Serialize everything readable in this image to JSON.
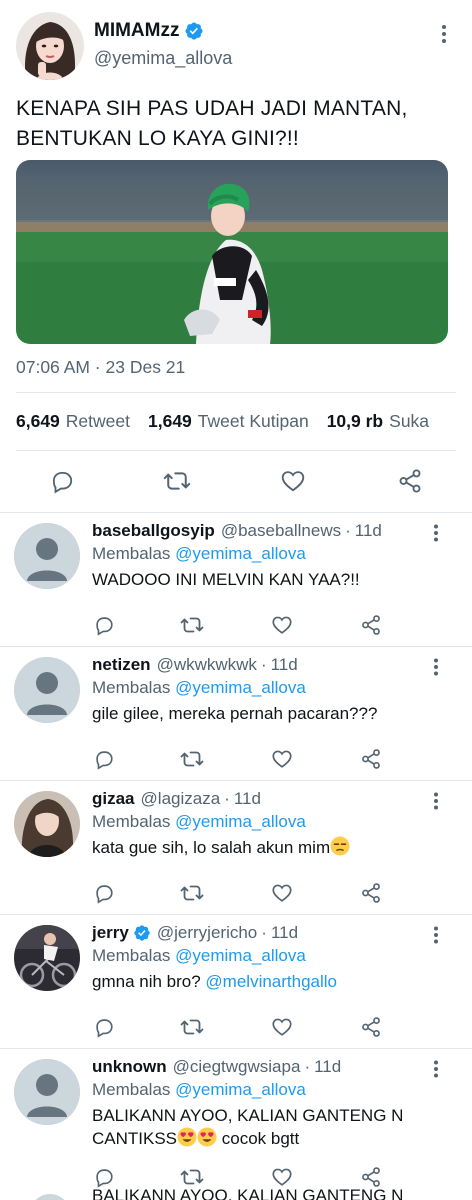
{
  "tweet": {
    "display_name": "MIMAMzz",
    "handle": "@yemima_allova",
    "text": "KENAPA SIH PAS UDAH JADI MANTAN, BENTUKAN LO KAYA GINI?!!",
    "timestamp": "07:06 AM · 23 Des 21",
    "stats": {
      "retweets_count": "6,649",
      "retweets_label": "Retweet",
      "quotes_count": "1,649",
      "quotes_label": "Tweet Kutipan",
      "likes_count": "10,9 rb",
      "likes_label": "Suka"
    },
    "icons": {
      "verified": "verified-badge-icon",
      "more": "more-vertical-icon",
      "reply": "reply-icon",
      "retweet": "retweet-icon",
      "like": "heart-icon",
      "share": "share-icon"
    }
  },
  "replies": [
    {
      "name": "baseballgosyip",
      "handle": "@baseballnews",
      "age": "11d",
      "verified": false,
      "replying_label": "Membalas",
      "replying_to": "@yemima_allova",
      "text": "WADOOO INI MELVIN KAN YAA?!!"
    },
    {
      "name": "netizen",
      "handle": "@wkwkwkwk",
      "age": "11d",
      "verified": false,
      "replying_label": "Membalas",
      "replying_to": "@yemima_allova",
      "text": "gile gilee, mereka pernah pacaran???"
    },
    {
      "name": "gizaa",
      "handle": "@lagizaza",
      "age": "11d",
      "verified": false,
      "replying_label": "Membalas",
      "replying_to": "@yemima_allova",
      "text": "kata gue sih, lo salah akun mim"
    },
    {
      "name": "jerry",
      "handle": "@jerryjericho",
      "age": "11d",
      "verified": true,
      "replying_label": "Membalas",
      "replying_to": "@yemima_allova",
      "text": "gmna nih bro?",
      "mention": "@melvinarthgallo"
    },
    {
      "name": "unknown",
      "handle": "@ciegtwgwsiapa",
      "age": "11d",
      "verified": false,
      "replying_label": "Membalas",
      "replying_to": "@yemima_allova",
      "text_line1": "BALIKANN AYOO, KALIAN GANTENG N",
      "text_line2_a": "CANTIKSS",
      "text_line2_b": "cocok bgtt"
    }
  ],
  "next_reply_partial": "BALIKANN AYOO, KALIAN GANTENG N",
  "colors": {
    "accent": "#1d9bf0",
    "secondary_text": "#536471",
    "primary_text": "#0f1419",
    "divider": "#e1e6ea",
    "default_avatar_bg": "#ccd6dd",
    "default_avatar_fg": "#66757f"
  }
}
